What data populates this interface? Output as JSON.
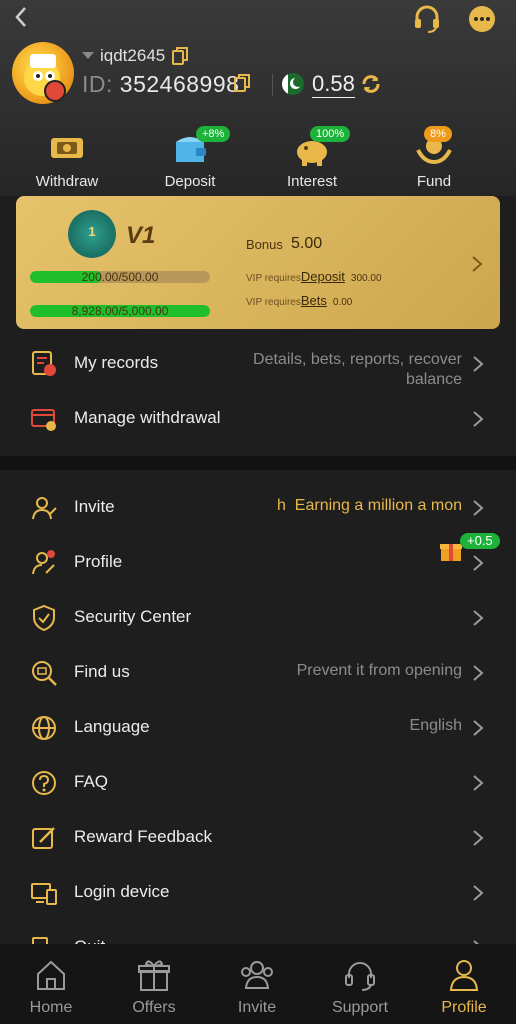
{
  "header": {
    "username": "iqdt2645",
    "id_label": "ID:",
    "id_value": "352468998",
    "balance": "0.58"
  },
  "quick_actions": [
    {
      "label": "Withdraw",
      "badge": ""
    },
    {
      "label": "Deposit",
      "badge": "+8%"
    },
    {
      "label": "Interest",
      "badge": "100%"
    },
    {
      "label": "Fund",
      "badge": "8%"
    }
  ],
  "vip": {
    "level": "V1",
    "medal_number": "1",
    "bonus_label": "Bonus",
    "bonus_value": "5.00",
    "deposit_progress_text": "200.00/500.00",
    "deposit_progress": 0.4,
    "bets_progress_text": "8,928.00/5,000.00",
    "bets_progress": 1.0,
    "requires_label": "VIP requires",
    "deposit_link": "Deposit",
    "deposit_amount": "300.00",
    "bets_link": "Bets",
    "bets_amount": "0.00"
  },
  "records": [
    {
      "label": "My records",
      "value": "Details, bets, reports, recover balance"
    },
    {
      "label": "Manage withdrawal",
      "value": ""
    }
  ],
  "menu": [
    {
      "label": "Invite",
      "value": "h  Earning a million a mon"
    },
    {
      "label": "Profile",
      "value": "",
      "badge": "+0.5"
    },
    {
      "label": "Security Center",
      "value": ""
    },
    {
      "label": "Find us",
      "value": "Prevent it from opening"
    },
    {
      "label": "Language",
      "value": "English"
    },
    {
      "label": "FAQ",
      "value": ""
    },
    {
      "label": "Reward Feedback",
      "value": ""
    },
    {
      "label": "Login device",
      "value": ""
    },
    {
      "label": "Quit",
      "value": ""
    }
  ],
  "nav": [
    {
      "label": "Home"
    },
    {
      "label": "Offers"
    },
    {
      "label": "Invite"
    },
    {
      "label": "Support"
    },
    {
      "label": "Profile"
    }
  ],
  "colors": {
    "accent": "#e8b84a",
    "vip_card": "#dcb75f",
    "progress": "#1fbf2c",
    "badge_green": "#1db33a"
  }
}
